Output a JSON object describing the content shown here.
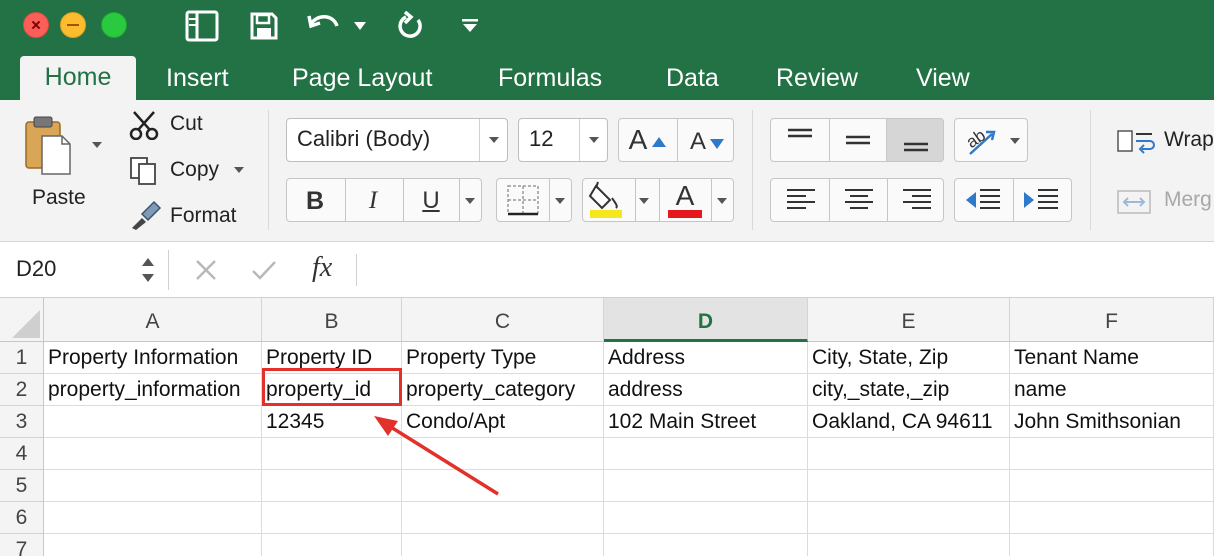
{
  "tabs": [
    "Home",
    "Insert",
    "Page Layout",
    "Formulas",
    "Data",
    "Review",
    "View"
  ],
  "clipboard": {
    "paste": "Paste",
    "cut": "Cut",
    "copy": "Copy",
    "format": "Format"
  },
  "font": {
    "name": "Calibri (Body)",
    "size": "12",
    "bold": "B",
    "italic": "I",
    "underline": "U",
    "grow": "A",
    "shrink": "A",
    "text_color_letter": "A"
  },
  "alignment": {
    "wrap": "Wrap",
    "merge": "Merg"
  },
  "formula_bar": {
    "name_box": "D20",
    "fx": "fx"
  },
  "colors": {
    "accent": "#227245",
    "highlight_yellow": "#f5e71d",
    "font_red": "#e3191d",
    "annotation_red": "#e2312a"
  },
  "grid": {
    "columns": [
      "A",
      "B",
      "C",
      "D",
      "E",
      "F"
    ],
    "rows": [
      "1",
      "2",
      "3",
      "4",
      "5",
      "6",
      "7"
    ],
    "cells": [
      [
        "Property Information",
        "Property ID",
        "Property Type",
        "Address",
        "City, State, Zip",
        "Tenant Name"
      ],
      [
        "property_information",
        "property_id",
        "property_category",
        "address",
        "city,_state,_zip",
        "name"
      ],
      [
        "",
        "12345",
        "Condo/Apt",
        "102 Main Street",
        "Oakland, CA 94611",
        "John Smithsonian"
      ],
      [
        "",
        "",
        "",
        "",
        "",
        ""
      ],
      [
        "",
        "",
        "",
        "",
        "",
        ""
      ],
      [
        "",
        "",
        "",
        "",
        "",
        ""
      ],
      [
        "",
        "",
        "",
        "",
        "",
        ""
      ]
    ]
  }
}
